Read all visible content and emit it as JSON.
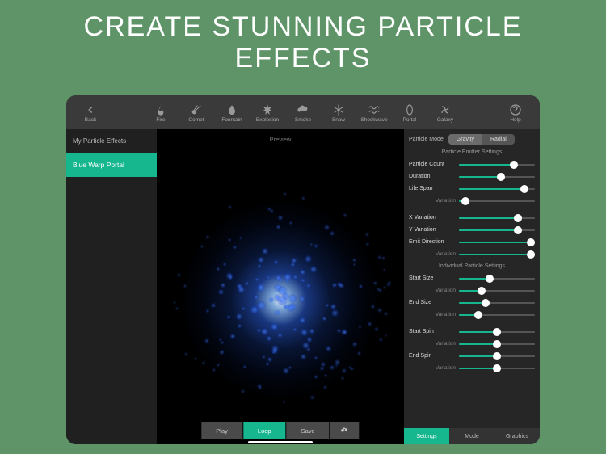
{
  "marketing": {
    "title_line1": "CREATE STUNNING PARTICLE",
    "title_line2": "EFFECTS"
  },
  "toolbar": {
    "back": "Back",
    "presets": [
      {
        "id": "fire",
        "label": "Fire"
      },
      {
        "id": "comet",
        "label": "Comet"
      },
      {
        "id": "fountain",
        "label": "Fountain"
      },
      {
        "id": "explosion",
        "label": "Explosion"
      },
      {
        "id": "smoke",
        "label": "Smoke"
      },
      {
        "id": "snow",
        "label": "Snow"
      },
      {
        "id": "shockwave",
        "label": "Shockwave"
      },
      {
        "id": "portal",
        "label": "Portal"
      },
      {
        "id": "galaxy",
        "label": "Galaxy"
      }
    ],
    "help": "Help"
  },
  "sidebar": {
    "title": "My Particle Effects",
    "items": [
      "Blue Warp Portal"
    ]
  },
  "preview": {
    "label": "Preview"
  },
  "bottom": {
    "play": "Play",
    "loop": "Loop",
    "save": "Save",
    "cloud": "cloud-upload"
  },
  "panel": {
    "mode_label": "Particle Mode",
    "mode_options": {
      "gravity": "Gravity",
      "radial": "Radial"
    },
    "mode_selected": "gravity",
    "section_emitter": "Particle Emitter Settings",
    "section_individual": "Individual Particle Settings",
    "sliders": {
      "particle_count": {
        "label": "Particle Count",
        "value": 0.72
      },
      "duration": {
        "label": "Duration",
        "value": 0.55
      },
      "life_span": {
        "label": "Life Span",
        "value": 0.86
      },
      "life_span_var": {
        "label": "Variation",
        "value": 0.08
      },
      "x_variation": {
        "label": "X Variation",
        "value": 0.78
      },
      "y_variation": {
        "label": "Y Variation",
        "value": 0.78
      },
      "emit_direction": {
        "label": "Emit Direction",
        "value": 0.95
      },
      "emit_dir_var": {
        "label": "Variation",
        "value": 0.95
      },
      "start_size": {
        "label": "Start Size",
        "value": 0.4
      },
      "start_size_var": {
        "label": "Variation",
        "value": 0.3
      },
      "end_size": {
        "label": "End Size",
        "value": 0.35
      },
      "end_size_var": {
        "label": "Variation",
        "value": 0.25
      },
      "start_spin": {
        "label": "Start Spin",
        "value": 0.5
      },
      "start_spin_var": {
        "label": "Variation",
        "value": 0.5
      },
      "end_spin": {
        "label": "End Spin",
        "value": 0.5
      },
      "end_spin_var": {
        "label": "Variation",
        "value": 0.5
      }
    },
    "tabs": {
      "settings": "Settings",
      "mode": "Mode",
      "graphics": "Graphics",
      "active": "settings"
    }
  },
  "colors": {
    "accent": "#16b68f"
  }
}
